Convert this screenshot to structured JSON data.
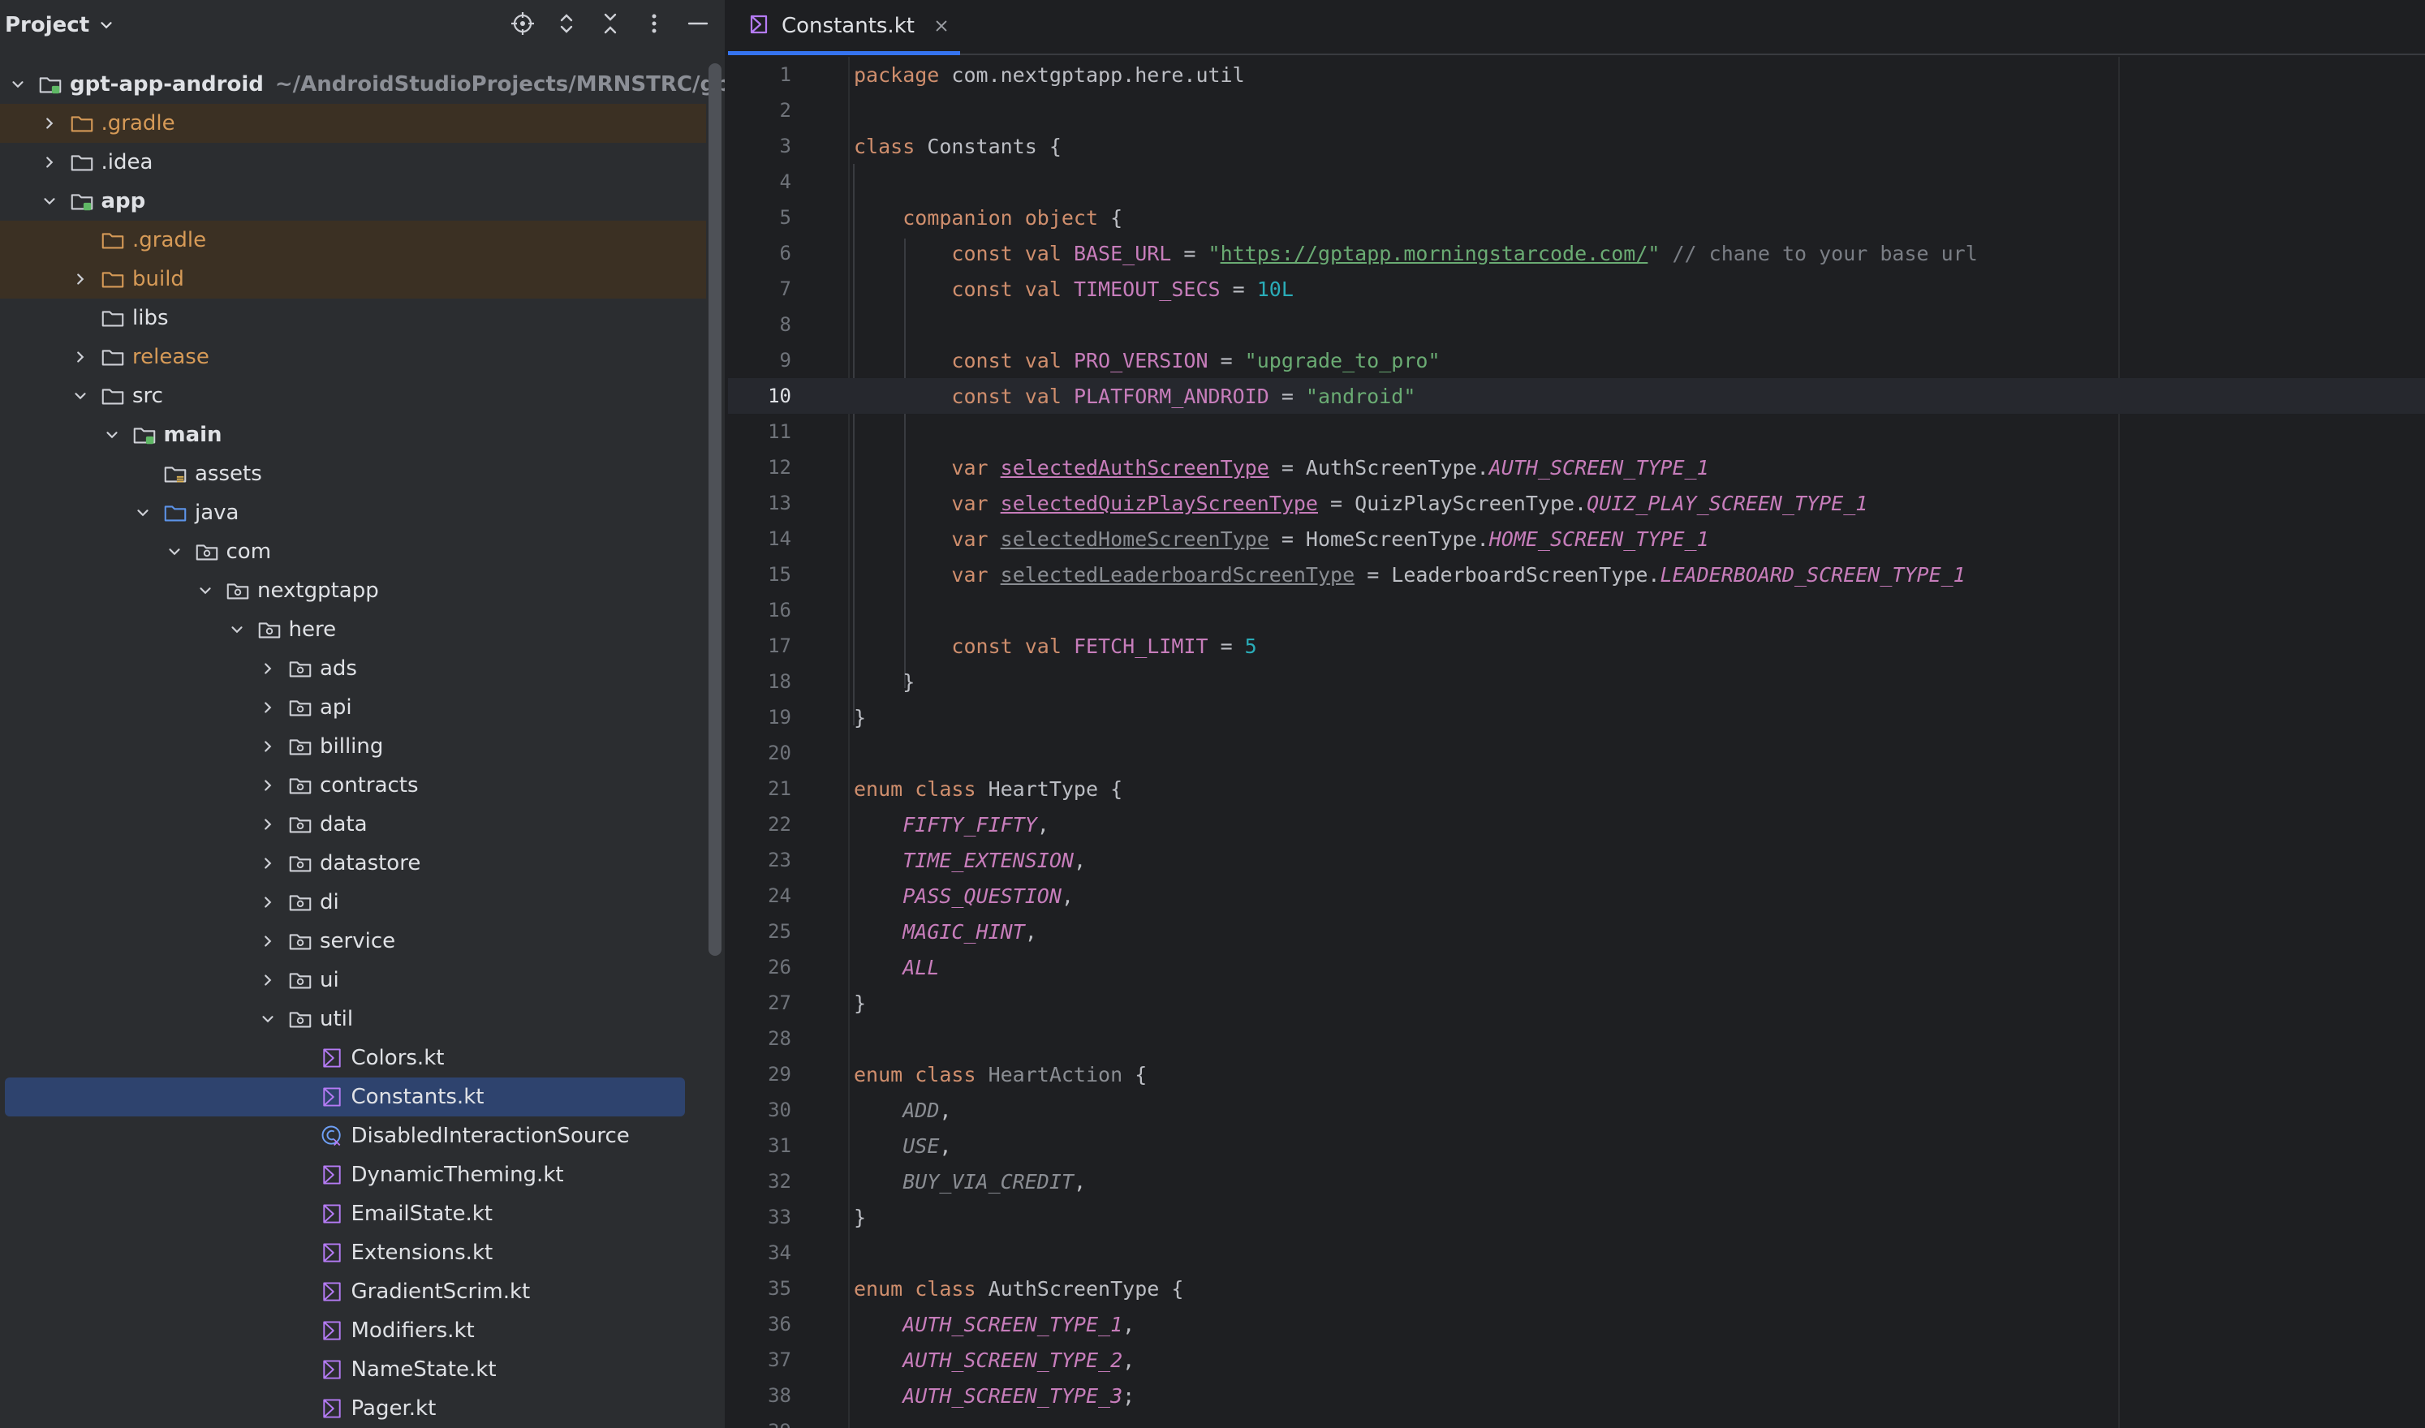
{
  "project_panel": {
    "title": "Project",
    "tools": [
      "locate-icon",
      "expand-all-icon",
      "collapse-all-icon",
      "more-options-icon",
      "hide-icon"
    ],
    "tree": [
      {
        "label": "gpt-app-android",
        "hint": "~/AndroidStudioProjects/MRNSTRC/gpt-app-",
        "depth": 0,
        "expanded": true,
        "icon": "module-folder-icon",
        "bold": true
      },
      {
        "label": ".gradle",
        "depth": 1,
        "expanded": false,
        "icon": "excluded-folder-icon",
        "excluded": true
      },
      {
        "label": ".idea",
        "depth": 1,
        "expanded": false,
        "icon": "folder-icon"
      },
      {
        "label": "app",
        "depth": 1,
        "expanded": true,
        "icon": "module-folder-icon",
        "bold": true
      },
      {
        "label": ".gradle",
        "depth": 2,
        "icon": "excluded-folder-icon",
        "excluded": true
      },
      {
        "label": "build",
        "depth": 2,
        "expanded": false,
        "icon": "excluded-folder-icon",
        "excluded": true
      },
      {
        "label": "libs",
        "depth": 2,
        "icon": "folder-icon"
      },
      {
        "label": "release",
        "depth": 2,
        "expanded": false,
        "icon": "folder-icon",
        "orange": true
      },
      {
        "label": "src",
        "depth": 2,
        "expanded": true,
        "icon": "folder-icon"
      },
      {
        "label": "main",
        "depth": 3,
        "expanded": true,
        "icon": "source-set-folder-icon",
        "bold": true
      },
      {
        "label": "assets",
        "depth": 4,
        "icon": "resources-folder-icon"
      },
      {
        "label": "java",
        "depth": 4,
        "expanded": true,
        "icon": "source-root-folder-icon"
      },
      {
        "label": "com",
        "depth": 5,
        "expanded": true,
        "icon": "package-icon"
      },
      {
        "label": "nextgptapp",
        "depth": 6,
        "expanded": true,
        "icon": "package-icon"
      },
      {
        "label": "here",
        "depth": 7,
        "expanded": true,
        "icon": "package-icon"
      },
      {
        "label": "ads",
        "depth": 8,
        "expanded": false,
        "icon": "package-icon"
      },
      {
        "label": "api",
        "depth": 8,
        "expanded": false,
        "icon": "package-icon"
      },
      {
        "label": "billing",
        "depth": 8,
        "expanded": false,
        "icon": "package-icon"
      },
      {
        "label": "contracts",
        "depth": 8,
        "expanded": false,
        "icon": "package-icon"
      },
      {
        "label": "data",
        "depth": 8,
        "expanded": false,
        "icon": "package-icon"
      },
      {
        "label": "datastore",
        "depth": 8,
        "expanded": false,
        "icon": "package-icon"
      },
      {
        "label": "di",
        "depth": 8,
        "expanded": false,
        "icon": "package-icon"
      },
      {
        "label": "service",
        "depth": 8,
        "expanded": false,
        "icon": "package-icon"
      },
      {
        "label": "ui",
        "depth": 8,
        "expanded": false,
        "icon": "package-icon"
      },
      {
        "label": "util",
        "depth": 8,
        "expanded": true,
        "icon": "package-icon"
      },
      {
        "label": "Colors.kt",
        "depth": 9,
        "icon": "kotlin-file-icon"
      },
      {
        "label": "Constants.kt",
        "depth": 9,
        "icon": "kotlin-file-icon",
        "selected": true
      },
      {
        "label": "DisabledInteractionSource",
        "depth": 9,
        "icon": "kotlin-class-icon"
      },
      {
        "label": "DynamicTheming.kt",
        "depth": 9,
        "icon": "kotlin-file-icon"
      },
      {
        "label": "EmailState.kt",
        "depth": 9,
        "icon": "kotlin-file-icon"
      },
      {
        "label": "Extensions.kt",
        "depth": 9,
        "icon": "kotlin-file-icon"
      },
      {
        "label": "GradientScrim.kt",
        "depth": 9,
        "icon": "kotlin-file-icon"
      },
      {
        "label": "Modifiers.kt",
        "depth": 9,
        "icon": "kotlin-file-icon"
      },
      {
        "label": "NameState.kt",
        "depth": 9,
        "icon": "kotlin-file-icon"
      },
      {
        "label": "Pager.kt",
        "depth": 9,
        "icon": "kotlin-file-icon"
      }
    ]
  },
  "editor": {
    "tab": {
      "label": "Constants.kt",
      "icon": "kotlin-file-icon"
    },
    "current_line": 10,
    "lines": [
      [
        [
          "kw",
          "package "
        ],
        [
          "ty",
          "com.nextgptapp.here.util"
        ]
      ],
      [],
      [
        [
          "kw",
          "class "
        ],
        [
          "ty",
          "Constants {"
        ]
      ],
      [],
      [
        [
          "ty",
          "    "
        ],
        [
          "kw",
          "companion object "
        ],
        [
          "ty",
          "{"
        ]
      ],
      [
        [
          "ty",
          "        "
        ],
        [
          "kw",
          "const val "
        ],
        [
          "const",
          "BASE_URL"
        ],
        [
          "ty",
          " = "
        ],
        [
          "str",
          "\""
        ],
        [
          "url",
          "https://gptapp.morningstarcode.com/"
        ],
        [
          "str",
          "\""
        ],
        [
          "cmt",
          " // chane to your base url"
        ]
      ],
      [
        [
          "ty",
          "        "
        ],
        [
          "kw",
          "const val "
        ],
        [
          "const",
          "TIMEOUT_SECS"
        ],
        [
          "ty",
          " = "
        ],
        [
          "num",
          "10L"
        ]
      ],
      [],
      [
        [
          "ty",
          "        "
        ],
        [
          "kw",
          "const val "
        ],
        [
          "const",
          "PRO_VERSION"
        ],
        [
          "ty",
          " = "
        ],
        [
          "str",
          "\"upgrade_to_pro\""
        ]
      ],
      [
        [
          "ty",
          "        "
        ],
        [
          "kw",
          "const val "
        ],
        [
          "const",
          "PLATFORM_ANDROID"
        ],
        [
          "ty",
          " = "
        ],
        [
          "str",
          "\"android\""
        ]
      ],
      [],
      [
        [
          "ty",
          "        "
        ],
        [
          "kw",
          "var "
        ],
        [
          "var",
          "selectedAuthScreenType"
        ],
        [
          "ty",
          " = AuthScreenType."
        ],
        [
          "enumc",
          "AUTH_SCREEN_TYPE_1"
        ]
      ],
      [
        [
          "ty",
          "        "
        ],
        [
          "kw",
          "var "
        ],
        [
          "var",
          "selectedQuizPlayScreenType"
        ],
        [
          "ty",
          " = QuizPlayScreenType."
        ],
        [
          "enumc",
          "QUIZ_PLAY_SCREEN_TYPE_1"
        ]
      ],
      [
        [
          "ty",
          "        "
        ],
        [
          "kw",
          "var "
        ],
        [
          "var dim",
          "selectedHomeScreenType"
        ],
        [
          "ty",
          " = HomeScreenType."
        ],
        [
          "enumc",
          "HOME_SCREEN_TYPE_1"
        ]
      ],
      [
        [
          "ty",
          "        "
        ],
        [
          "kw",
          "var "
        ],
        [
          "var dim",
          "selectedLeaderboardScreenType"
        ],
        [
          "ty",
          " = LeaderboardScreenType."
        ],
        [
          "enumc",
          "LEADERBOARD_SCREEN_TYPE_1"
        ]
      ],
      [],
      [
        [
          "ty",
          "        "
        ],
        [
          "kw",
          "const val "
        ],
        [
          "const",
          "FETCH_LIMIT"
        ],
        [
          "ty",
          " = "
        ],
        [
          "num",
          "5"
        ]
      ],
      [
        [
          "ty",
          "    }"
        ]
      ],
      [
        [
          "ty",
          "}"
        ]
      ],
      [],
      [
        [
          "kw",
          "enum class "
        ],
        [
          "ty",
          "HeartType {"
        ]
      ],
      [
        [
          "ty",
          "    "
        ],
        [
          "enumc",
          "FIFTY_FIFTY"
        ],
        [
          "ty",
          ","
        ]
      ],
      [
        [
          "ty",
          "    "
        ],
        [
          "enumc",
          "TIME_EXTENSION"
        ],
        [
          "ty",
          ","
        ]
      ],
      [
        [
          "ty",
          "    "
        ],
        [
          "enumc",
          "PASS_QUESTION"
        ],
        [
          "ty",
          ","
        ]
      ],
      [
        [
          "ty",
          "    "
        ],
        [
          "enumc",
          "MAGIC_HINT"
        ],
        [
          "ty",
          ","
        ]
      ],
      [
        [
          "ty",
          "    "
        ],
        [
          "enumc",
          "ALL"
        ]
      ],
      [
        [
          "ty",
          "}"
        ]
      ],
      [],
      [
        [
          "kw",
          "enum class "
        ],
        [
          "ty dim",
          "HeartAction"
        ],
        [
          "ty",
          " {"
        ]
      ],
      [
        [
          "ty",
          "    "
        ],
        [
          "enumc dim",
          "ADD"
        ],
        [
          "ty",
          ","
        ]
      ],
      [
        [
          "ty",
          "    "
        ],
        [
          "enumc dim",
          "USE"
        ],
        [
          "ty",
          ","
        ]
      ],
      [
        [
          "ty",
          "    "
        ],
        [
          "enumc dim",
          "BUY_VIA_CREDIT"
        ],
        [
          "ty",
          ","
        ]
      ],
      [
        [
          "ty",
          "}"
        ]
      ],
      [],
      [
        [
          "kw",
          "enum class "
        ],
        [
          "ty",
          "AuthScreenType {"
        ]
      ],
      [
        [
          "ty",
          "    "
        ],
        [
          "enumc",
          "AUTH_SCREEN_TYPE_1"
        ],
        [
          "ty",
          ","
        ]
      ],
      [
        [
          "ty",
          "    "
        ],
        [
          "enumc",
          "AUTH_SCREEN_TYPE_2"
        ],
        [
          "ty",
          ","
        ]
      ],
      [
        [
          "ty",
          "    "
        ],
        [
          "enumc",
          "AUTH_SCREEN_TYPE_3"
        ],
        [
          "ty",
          ";"
        ]
      ],
      []
    ]
  }
}
